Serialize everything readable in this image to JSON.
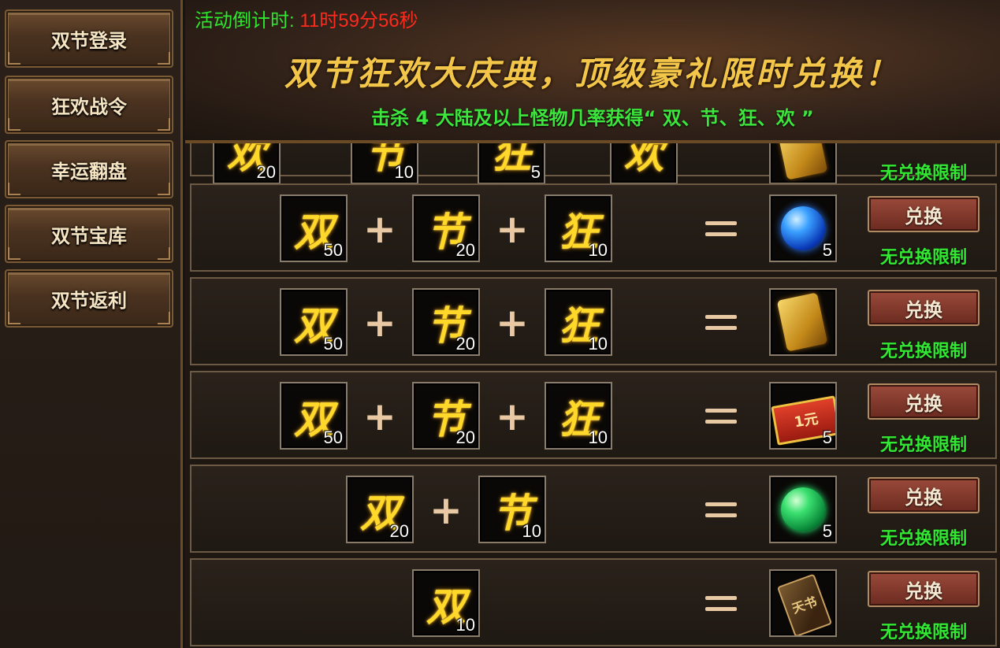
{
  "sidebar": {
    "tabs": [
      {
        "label": "双节登录"
      },
      {
        "label": "狂欢战令"
      },
      {
        "label": "幸运翻盘"
      },
      {
        "label": "双节宝库"
      },
      {
        "label": "双节返利"
      }
    ]
  },
  "banner": {
    "countdown_label": "活动倒计时: ",
    "countdown_value": "11时59分56秒",
    "headline": "双节狂欢大庆典，顶级豪礼限时兑换！",
    "subline": "击杀 4 大陆及以上怪物几率获得“ 双、节、狂、欢 ”"
  },
  "symbols": {
    "plus": "+",
    "equal": "="
  },
  "colors": {
    "countdown_label": "#2ee62e",
    "countdown_value": "#ff2a1e",
    "headline": "#f3c64a",
    "limit_text": "#33e833",
    "item_glyph": "#ffd82a",
    "button_bg": "#8a3a2c"
  },
  "rows": [
    {
      "items": [
        {
          "glyph": "欢",
          "count": "20"
        },
        {
          "glyph": "节",
          "count": "10"
        },
        {
          "glyph": "狂",
          "count": "5"
        },
        {
          "glyph": "欢",
          "count": ""
        }
      ],
      "reward": {
        "icon": "scroll-icon",
        "count": ""
      },
      "limit": "无兑换限制"
    },
    {
      "items": [
        {
          "glyph": "双",
          "count": "50"
        },
        {
          "glyph": "节",
          "count": "20"
        },
        {
          "glyph": "狂",
          "count": "10"
        }
      ],
      "reward": {
        "icon": "blue-orb-icon",
        "count": "5"
      },
      "button": "兑换",
      "limit": "无兑换限制"
    },
    {
      "items": [
        {
          "glyph": "双",
          "count": "50"
        },
        {
          "glyph": "节",
          "count": "20"
        },
        {
          "glyph": "狂",
          "count": "10"
        }
      ],
      "reward": {
        "icon": "golden-scroll-icon",
        "count": ""
      },
      "button": "兑换",
      "limit": "无兑换限制"
    },
    {
      "items": [
        {
          "glyph": "双",
          "count": "50"
        },
        {
          "glyph": "节",
          "count": "20"
        },
        {
          "glyph": "狂",
          "count": "10"
        }
      ],
      "reward": {
        "icon": "red-card-icon",
        "label": "1元",
        "count": "5"
      },
      "button": "兑换",
      "limit": "无兑换限制"
    },
    {
      "items": [
        {
          "glyph": "双",
          "count": "20"
        },
        {
          "glyph": "节",
          "count": "10"
        }
      ],
      "reward": {
        "icon": "green-orb-icon",
        "count": "5"
      },
      "button": "兑换",
      "limit": "无兑换限制"
    },
    {
      "items": [
        {
          "glyph": "双",
          "count": "10"
        }
      ],
      "reward": {
        "icon": "token-icon",
        "label": "天书",
        "count": ""
      },
      "button": "兑换",
      "limit": "无兑换限制"
    }
  ]
}
